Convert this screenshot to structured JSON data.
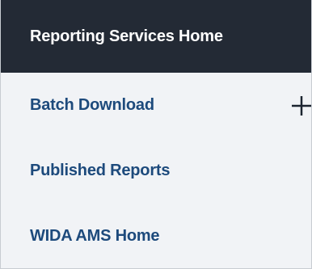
{
  "nav": {
    "header": "Reporting Services Home",
    "items": [
      {
        "label": "Batch Download",
        "icon": "plus-icon"
      },
      {
        "label": "Published Reports"
      },
      {
        "label": "WIDA AMS Home"
      }
    ]
  },
  "colors": {
    "header_bg": "#232a35",
    "header_text": "#ffffff",
    "panel_bg": "#f1f3f6",
    "link_text": "#1d4a7c",
    "icon": "#1b2430"
  }
}
